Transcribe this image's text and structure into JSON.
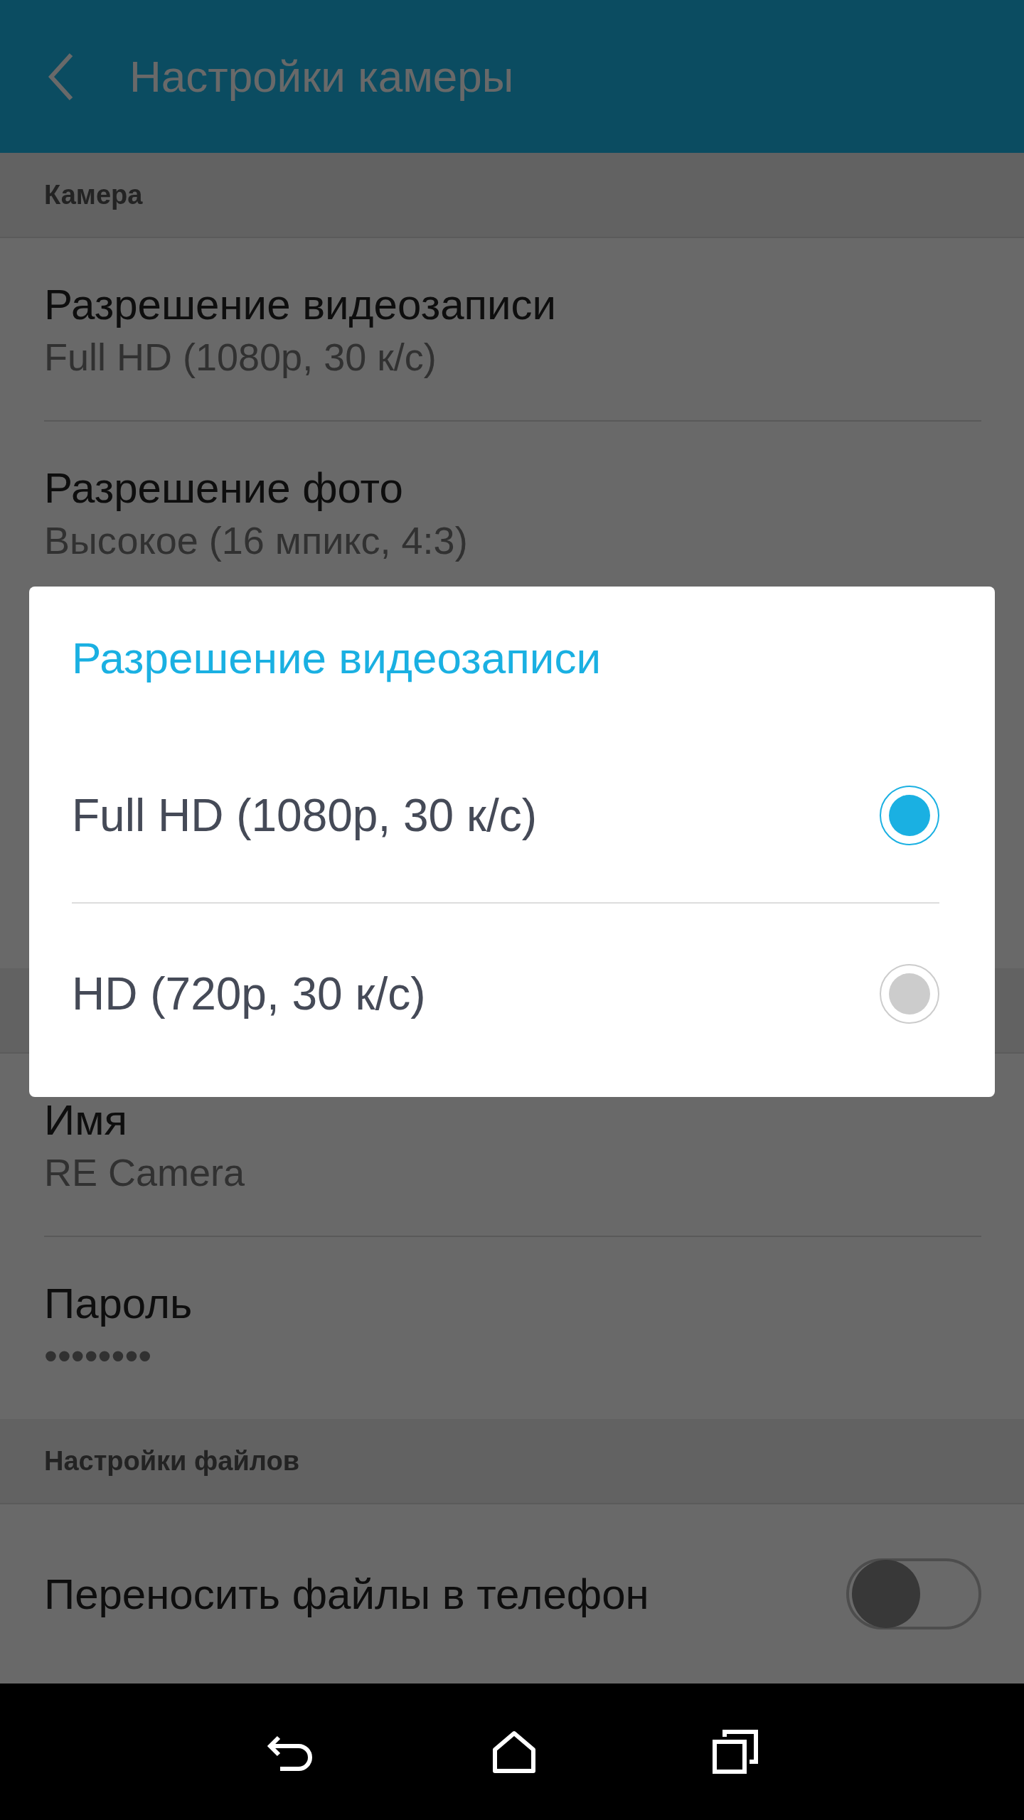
{
  "app_bar": {
    "title": "Настройки камеры"
  },
  "sections": [
    {
      "header": "Камера",
      "items": [
        {
          "kind": "value",
          "title": "Разрешение видеозаписи",
          "value": "Full HD (1080p, 30 к/с)"
        },
        {
          "kind": "value",
          "title": "Разрешение фото",
          "value": "Высокое (16 мпикс, 4:3)"
        }
      ]
    },
    {
      "items": [
        {
          "kind": "value",
          "title": "Имя",
          "value": "RE Camera"
        },
        {
          "kind": "value",
          "title": "Пароль",
          "value": "••••••••"
        }
      ]
    },
    {
      "header": "Настройки файлов",
      "items": [
        {
          "kind": "switch",
          "title": "Переносить файлы в телефон",
          "on": false
        }
      ]
    }
  ],
  "dialog": {
    "title": "Разрешение видеозаписи",
    "options": [
      {
        "label": "Full HD (1080p, 30 к/с)",
        "selected": true
      },
      {
        "label": "HD (720p, 30 к/с)",
        "selected": false
      }
    ]
  }
}
